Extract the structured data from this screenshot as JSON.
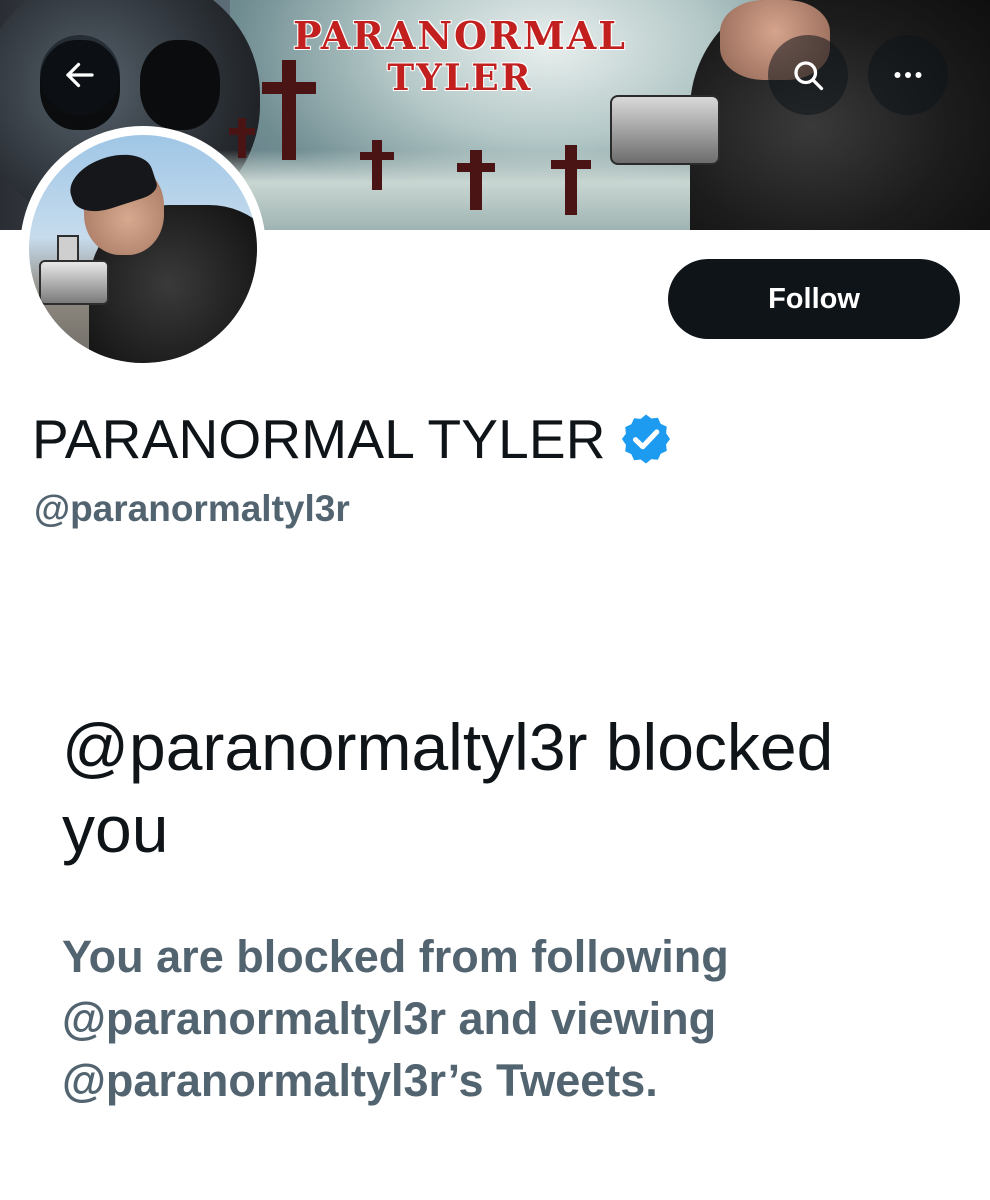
{
  "banner": {
    "title_line1": "PARANORMAL",
    "title_line2": "TYLER"
  },
  "header": {
    "back_icon": "arrow-left-icon",
    "search_icon": "search-icon",
    "more_icon": "more-horizontal-icon"
  },
  "profile": {
    "display_name": "PARANORMAL TYLER",
    "verified_icon": "verified-badge-icon",
    "verified_color": "#1d9bf0",
    "handle": "@paranormaltyl3r",
    "follow_label": "Follow"
  },
  "blocked": {
    "title": "@paranormaltyl3r blocked you",
    "description": "You are blocked from following @paranormaltyl3r and viewing @paranormaltyl3r’s Tweets."
  },
  "colors": {
    "primary_text": "#0f1419",
    "secondary_text": "#536471",
    "follow_button_bg": "#0f1419",
    "banner_title_red": "#c21f1f"
  }
}
